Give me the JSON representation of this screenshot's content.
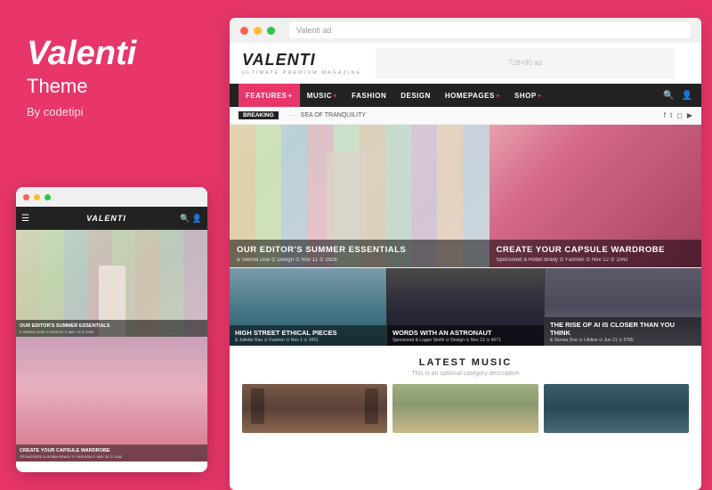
{
  "left": {
    "title": "Valenti",
    "subtitle": "Theme",
    "by": "By codetipi"
  },
  "mini_browser": {
    "logo": "VALENTI",
    "nav_icon": "☰",
    "search_icon": "🔍",
    "user_icon": "👤",
    "card1_title": "OUR EDITOR'S SUMMER ESSENTIALS",
    "card1_meta": "& Sienna Doe  ⊙ Design  ⊙ May 19  ⊙ 2928",
    "card2_title": "CREATE YOUR CAPSULE WARDROBE",
    "card2_meta": "Sponsored  & Robin Brady  ⊙ Fashion  ⊙ May 15  ⊙ 1042"
  },
  "main_browser": {
    "url": "Valenti ad",
    "logo": "VALENTI",
    "logo_sub": "ULTIMATE PREMIUM MAGAZINE",
    "ad_text": "728×90 ad",
    "nav": {
      "items": [
        {
          "label": "FEATURES",
          "active": true,
          "has_plus": true
        },
        {
          "label": "MUSIC",
          "active": false,
          "has_plus": true
        },
        {
          "label": "FASHION",
          "active": false,
          "has_plus": false
        },
        {
          "label": "DESIGN",
          "active": false,
          "has_plus": false
        },
        {
          "label": "HOMEPAGES",
          "active": false,
          "has_plus": true
        },
        {
          "label": "SHOP",
          "active": false,
          "has_plus": true
        }
      ]
    },
    "breaking": {
      "label": "BREAKING",
      "sep": "—",
      "text": "SEA OF TRANQUILITY"
    },
    "hero": {
      "left_title": "OUR EDITOR'S SUMMER ESSENTIALS",
      "left_meta": "& Sienna Doe  ⊙ Design  ⊙ Nov 11  ⊙ 2928",
      "right_title": "CREATE YOUR CAPSULE WARDROBE",
      "right_meta": "Sponsored  & Robin Brady  ⊙ Fashion  ⊙ Nov 12  ⊙ 1042"
    },
    "second_row": [
      {
        "title": "HIGH STREET ETHICAL PIECES",
        "meta": "& Juliette Rao  ⊙ Fashion  ⊙ Nov 1  ⊙ 3421"
      },
      {
        "title": "WORDS WITH AN ASTRONAUT",
        "meta": "Sponsored  & Logan Smith  ⊙ Design  ⊙ Nov 13  ⊙ 4671"
      },
      {
        "title": "THE RISE OF AI IS CLOSER THAN YOU THINK",
        "meta": "& Sienna Doe  ⊙ Lifeline  ⊙ Jun 21  ⊙ 5785"
      }
    ],
    "latest": {
      "title": "LATEST MUSIC",
      "description": "This is an optional category description"
    }
  }
}
